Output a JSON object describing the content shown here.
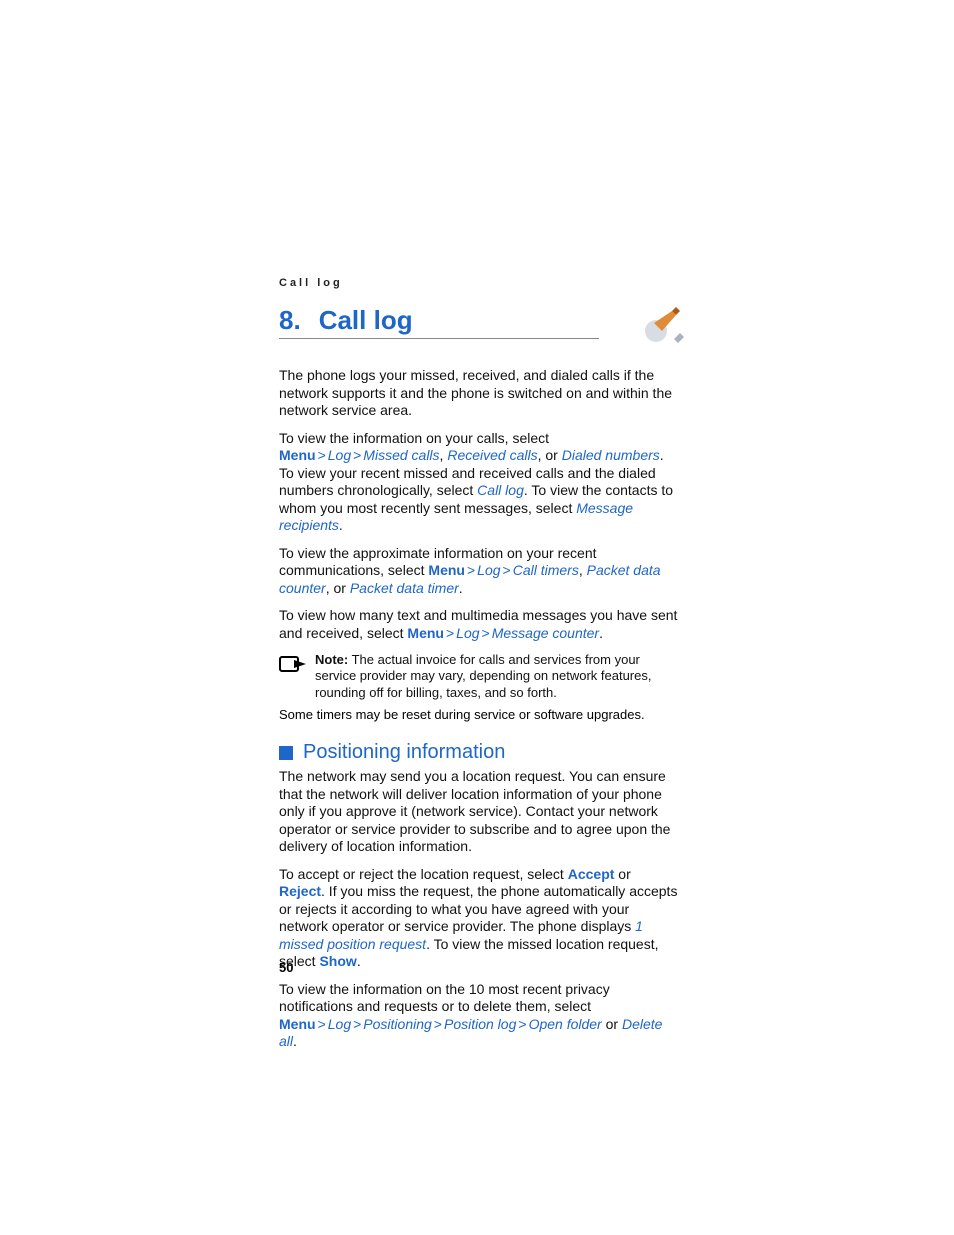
{
  "header": {
    "running": "Call log"
  },
  "chapter": {
    "number": "8.",
    "title": "Call log"
  },
  "paragraphs": {
    "intro": "The phone logs your missed, received, and dialed calls if the network supports it and the phone is switched on and within the network service area.",
    "p2a": "To view the information on your calls, select ",
    "p2b": ". To view your recent missed and received calls and the dialed numbers chronologically, select ",
    "p2c": ". To view the contacts to whom you most recently sent messages, select ",
    "p3a": "To view the approximate information on your recent communications, select ",
    "p4a": "To view how many text and multimedia messages you have sent and received, select ",
    "reset": "Some timers may be reset during service or software upgrades.",
    "pos1": "The network may send you a location request. You can ensure that the network will deliver location information of your phone only if you approve it (network service). Contact your network operator or service provider to subscribe and to agree upon the delivery of location information.",
    "pos2a": "To accept or reject the location request, select ",
    "pos2b": ". If you miss the request, the phone automatically accepts or rejects it according to what you have agreed with your network operator or service provider. The phone displays ",
    "pos2c": ". To view the missed location request, select ",
    "pos3a": "To view the information on the 10 most recent privacy notifications and requests or to delete them, select "
  },
  "links": {
    "menu": "Menu",
    "log": "Log",
    "missed": "Missed calls",
    "received": "Received calls",
    "dialed": "Dialed numbers",
    "calllog": "Call log",
    "msgrec": "Message recipients",
    "calltimers": "Call timers",
    "pdc": "Packet data counter",
    "pdt": "Packet data timer",
    "msgcounter": "Message counter",
    "accept": "Accept",
    "reject": "Reject",
    "missedpos": "1 missed position request",
    "show": "Show",
    "positioning": "Positioning",
    "poslog": "Position log",
    "openfolder": "Open folder",
    "deleteall": "Delete all"
  },
  "connectors": {
    "gt": ">",
    "or": ", or ",
    "comma_or": ", or ",
    "or_word": " or ",
    "comma": ", ",
    "period": "."
  },
  "note": {
    "label": "Note:",
    "text": " The actual invoice for calls and services from your service provider may vary, depending on network features, rounding off for billing, taxes, and so forth."
  },
  "section": {
    "title": "Positioning information"
  },
  "footer": {
    "page": "50"
  }
}
